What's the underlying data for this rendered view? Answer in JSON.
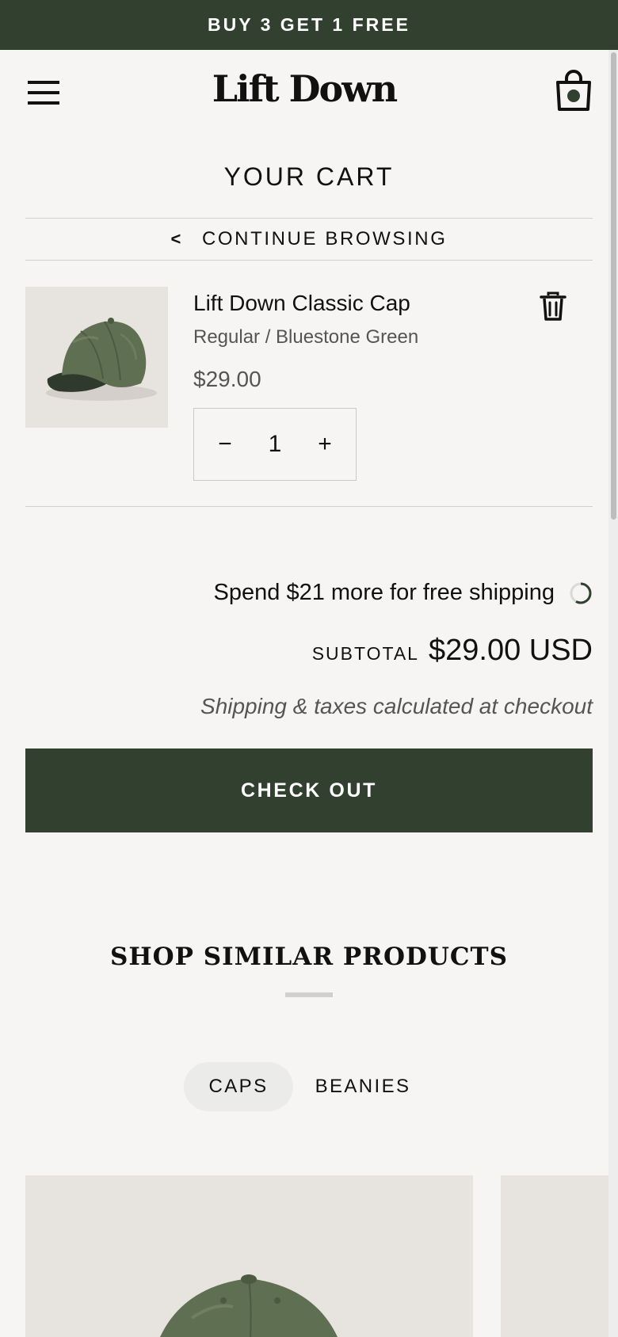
{
  "announcement": "BUY 3 GET 1 FREE",
  "header": {
    "logo": "Lift Down",
    "menu_icon": "hamburger-icon",
    "cart_icon": "shopping-bag-icon"
  },
  "cart": {
    "title": "YOUR CART",
    "continue_label": "CONTINUE BROWSING",
    "items": [
      {
        "name": "Lift Down Classic Cap",
        "variant": "Regular / Bluestone Green",
        "price": "$29.00",
        "quantity": "1",
        "minus_label": "−",
        "plus_label": "+"
      }
    ]
  },
  "summary": {
    "shipping_message": "Spend $21 more for free shipping",
    "free_shipping_progress": 0.58,
    "subtotal_label": "SUBTOTAL",
    "subtotal_value": "$29.00 USD",
    "tax_note": "Shipping & taxes calculated at checkout",
    "checkout_label": "CHECK OUT"
  },
  "similar": {
    "title": "SHOP SIMILAR PRODUCTS",
    "tabs": [
      {
        "label": "CAPS",
        "active": true
      },
      {
        "label": "BEANIES",
        "active": false
      }
    ]
  },
  "colors": {
    "brand_green": "#324030",
    "background": "#f7f5f3",
    "product_bg": "#e7e3df",
    "cap_green": "#5f6f52"
  }
}
